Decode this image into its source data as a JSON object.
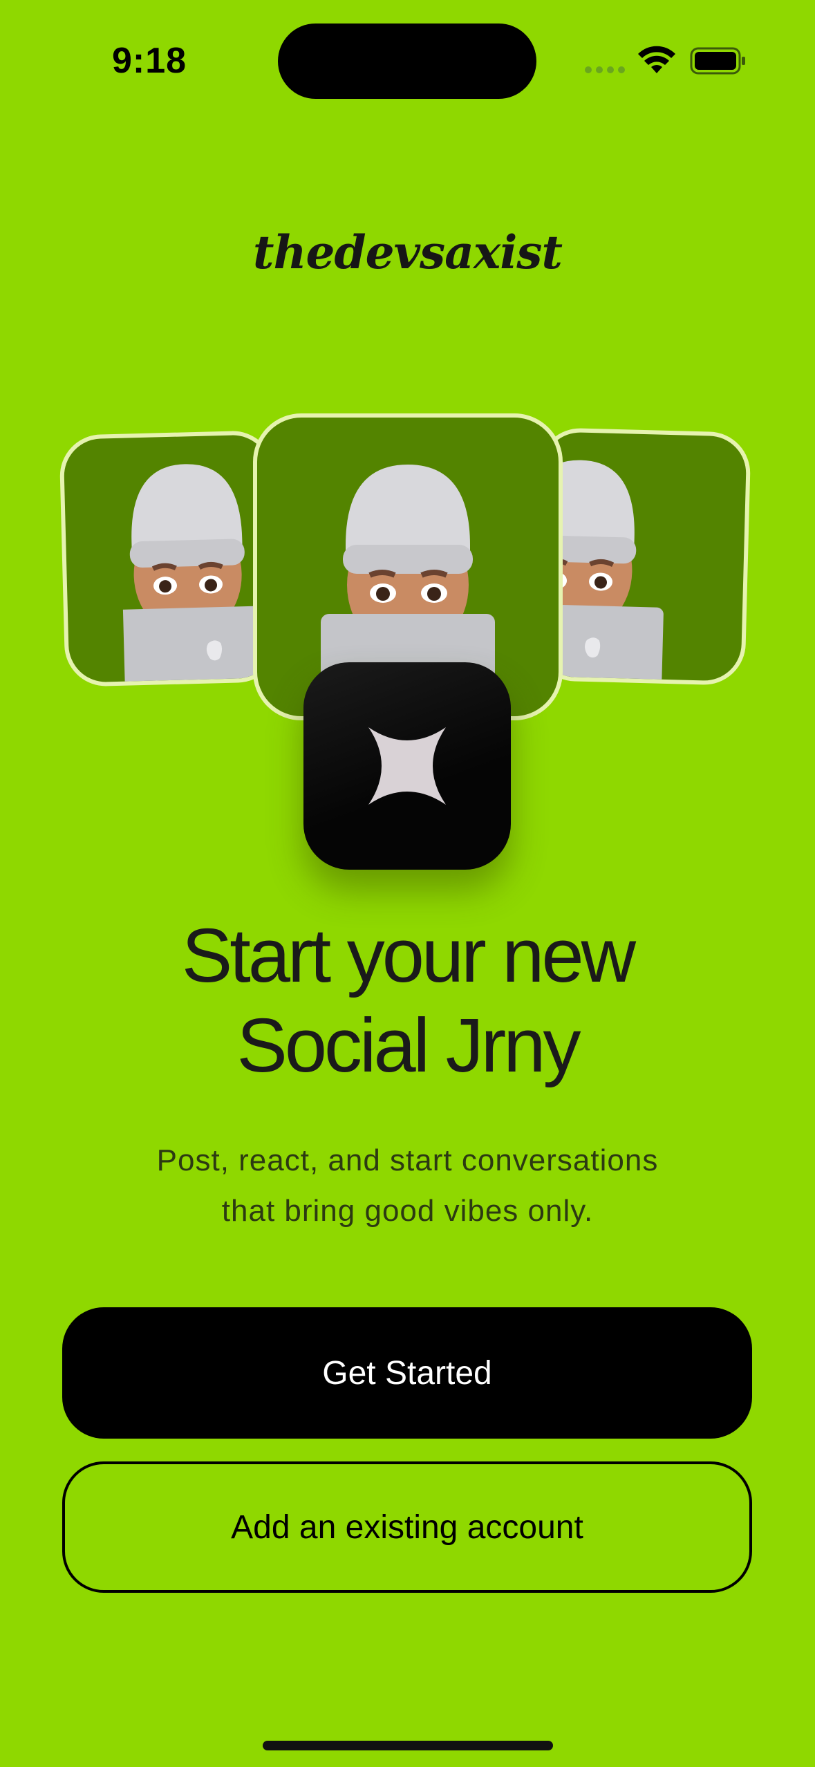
{
  "status_bar": {
    "time": "9:18"
  },
  "brand": {
    "name": "thedevsaxist"
  },
  "hero": {
    "headline_line1": "Start your new",
    "headline_line2": "Social Jrny",
    "subtitle_line1": "Post, react, and start conversations",
    "subtitle_line2": "that bring good vibes only."
  },
  "actions": {
    "primary_label": "Get Started",
    "secondary_label": "Add an existing account"
  },
  "icons": {
    "app_icon": "sparkle-star-icon",
    "avatar": "memoji-avatar"
  },
  "colors": {
    "background": "#8fd800",
    "card_background": "#538400",
    "card_border": "#e6f3b0",
    "primary_button": "#000000",
    "text": "#1a1a1a"
  }
}
